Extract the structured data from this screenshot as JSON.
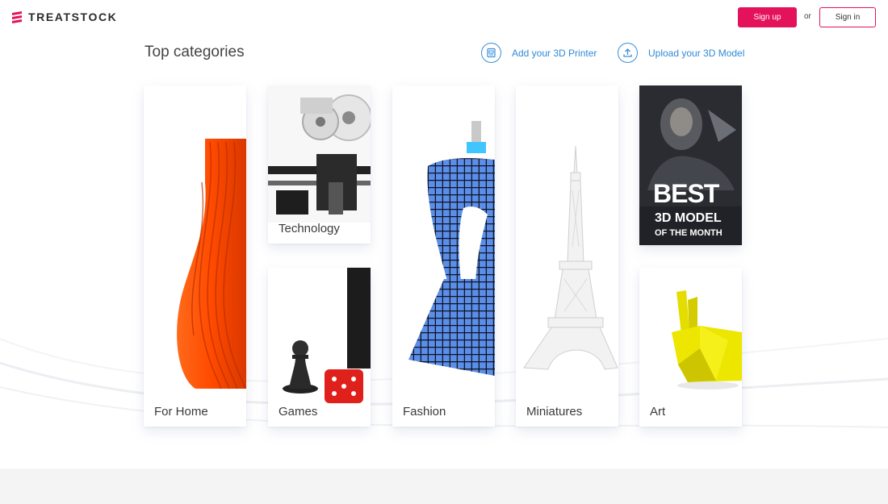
{
  "header": {
    "brand": "TREATSTOCK",
    "signup_label": "Sign up",
    "or_label": "or",
    "signin_label": "Sign in",
    "accent_color": "#e4125a"
  },
  "section": {
    "title": "Top categories",
    "add_printer_label": "Add your 3D Printer",
    "upload_model_label": "Upload your 3D Model",
    "link_color": "#2f8ad6"
  },
  "categories": [
    {
      "label": "For Home"
    },
    {
      "label": "Technology"
    },
    {
      "label": "Games"
    },
    {
      "label": "Fashion"
    },
    {
      "label": "Miniatures"
    },
    {
      "label": "Art"
    }
  ],
  "promo": {
    "line1": "BEST",
    "line2": "3D MODEL",
    "line3": "OF THE MONTH"
  }
}
